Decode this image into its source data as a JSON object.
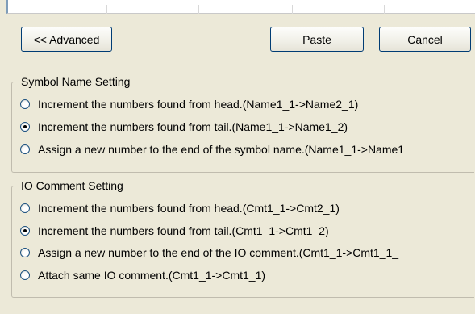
{
  "buttons": {
    "advanced_label": "<< Advanced",
    "paste_label": "Paste",
    "cancel_label": "Cancel"
  },
  "symbol_group": {
    "title": "Symbol Name Setting",
    "options": [
      {
        "label": "Increment the numbers found from head.(Name1_1->Name2_1)",
        "selected": false
      },
      {
        "label": "Increment the numbers found from tail.(Name1_1->Name1_2)",
        "selected": true
      },
      {
        "label": "Assign a new number to the end of the symbol name.(Name1_1->Name1",
        "selected": false
      }
    ]
  },
  "io_group": {
    "title": "IO Comment Setting",
    "options": [
      {
        "label": "Increment the numbers found from head.(Cmt1_1->Cmt2_1)",
        "selected": false
      },
      {
        "label": "Increment the numbers found from tail.(Cmt1_1->Cmt1_2)",
        "selected": true
      },
      {
        "label": "Assign a new number to the end of the IO comment.(Cmt1_1->Cmt1_1_",
        "selected": false
      },
      {
        "label": "Attach same IO comment.(Cmt1_1->Cmt1_1)",
        "selected": false
      }
    ]
  },
  "colors": {
    "dialog_bg": "#ece9d8",
    "button_border": "#003c74",
    "radio_selected": "#000000"
  }
}
